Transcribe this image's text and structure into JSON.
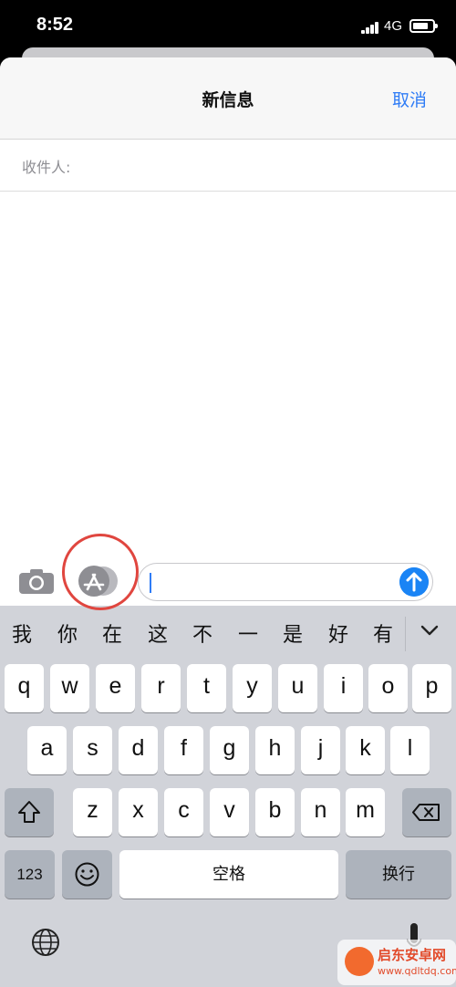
{
  "status_bar": {
    "time": "8:52",
    "network": "4G"
  },
  "nav": {
    "title": "新信息",
    "cancel_label": "取消"
  },
  "recipient": {
    "label": "收件人:"
  },
  "compose": {
    "placeholder": ""
  },
  "candidates": [
    "我",
    "你",
    "在",
    "这",
    "不",
    "一",
    "是",
    "好",
    "有"
  ],
  "keyboard": {
    "row1": [
      "q",
      "w",
      "e",
      "r",
      "t",
      "y",
      "u",
      "i",
      "o",
      "p"
    ],
    "row2": [
      "a",
      "s",
      "d",
      "f",
      "g",
      "h",
      "j",
      "k",
      "l"
    ],
    "row3": [
      "z",
      "x",
      "c",
      "v",
      "b",
      "n",
      "m"
    ],
    "numbers_label": "123",
    "space_label": "空格",
    "return_label": "换行"
  },
  "watermark": {
    "name": "启东安卓网",
    "url": "www.qdltdq.com"
  },
  "icons": [
    "camera-icon",
    "app-store-icon",
    "send-arrow-icon",
    "shift-icon",
    "backspace-icon",
    "emoji-icon",
    "globe-icon",
    "microphone-icon",
    "chevron-down-icon"
  ],
  "colors": {
    "accent": "#2f7cf6",
    "send": "#1a84f5",
    "keyboard_bg": "#d1d3d9",
    "annotation": "#e0463f"
  }
}
